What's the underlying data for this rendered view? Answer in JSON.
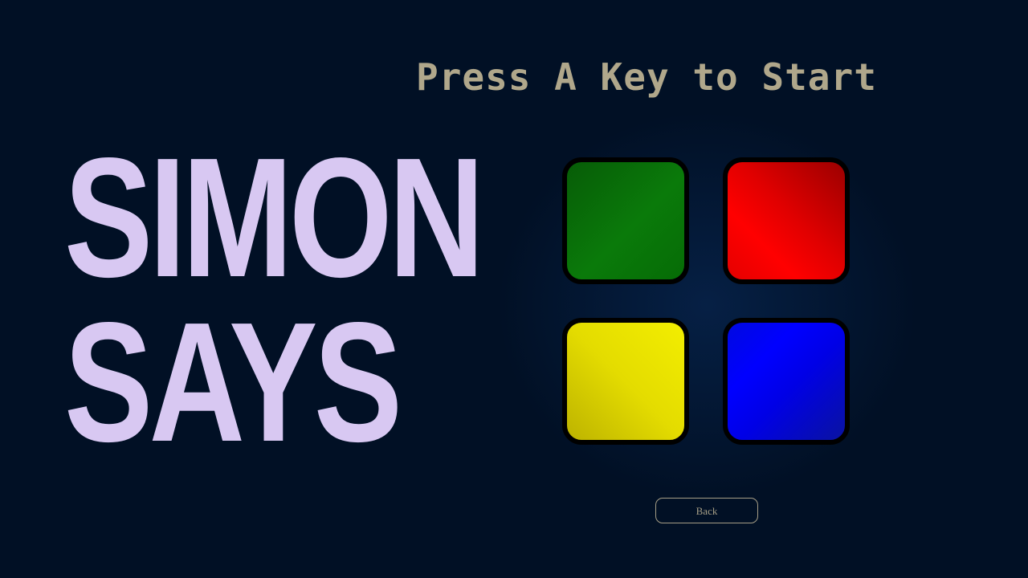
{
  "prompt": {
    "text": "Press A Key to Start"
  },
  "title": {
    "line1": "SIMON",
    "line2": "SAYS"
  },
  "pads": [
    {
      "name": "green",
      "color": "#0a7a0a"
    },
    {
      "name": "red",
      "color": "#ff0000"
    },
    {
      "name": "yellow",
      "color": "#f3ee00"
    },
    {
      "name": "blue",
      "color": "#0000ff"
    }
  ],
  "colors": {
    "background": "#011025",
    "title_text": "#d8c8f2",
    "prompt_text": "#b0a78b",
    "pad_border": "#000000"
  },
  "back_button": {
    "label": "Back"
  }
}
